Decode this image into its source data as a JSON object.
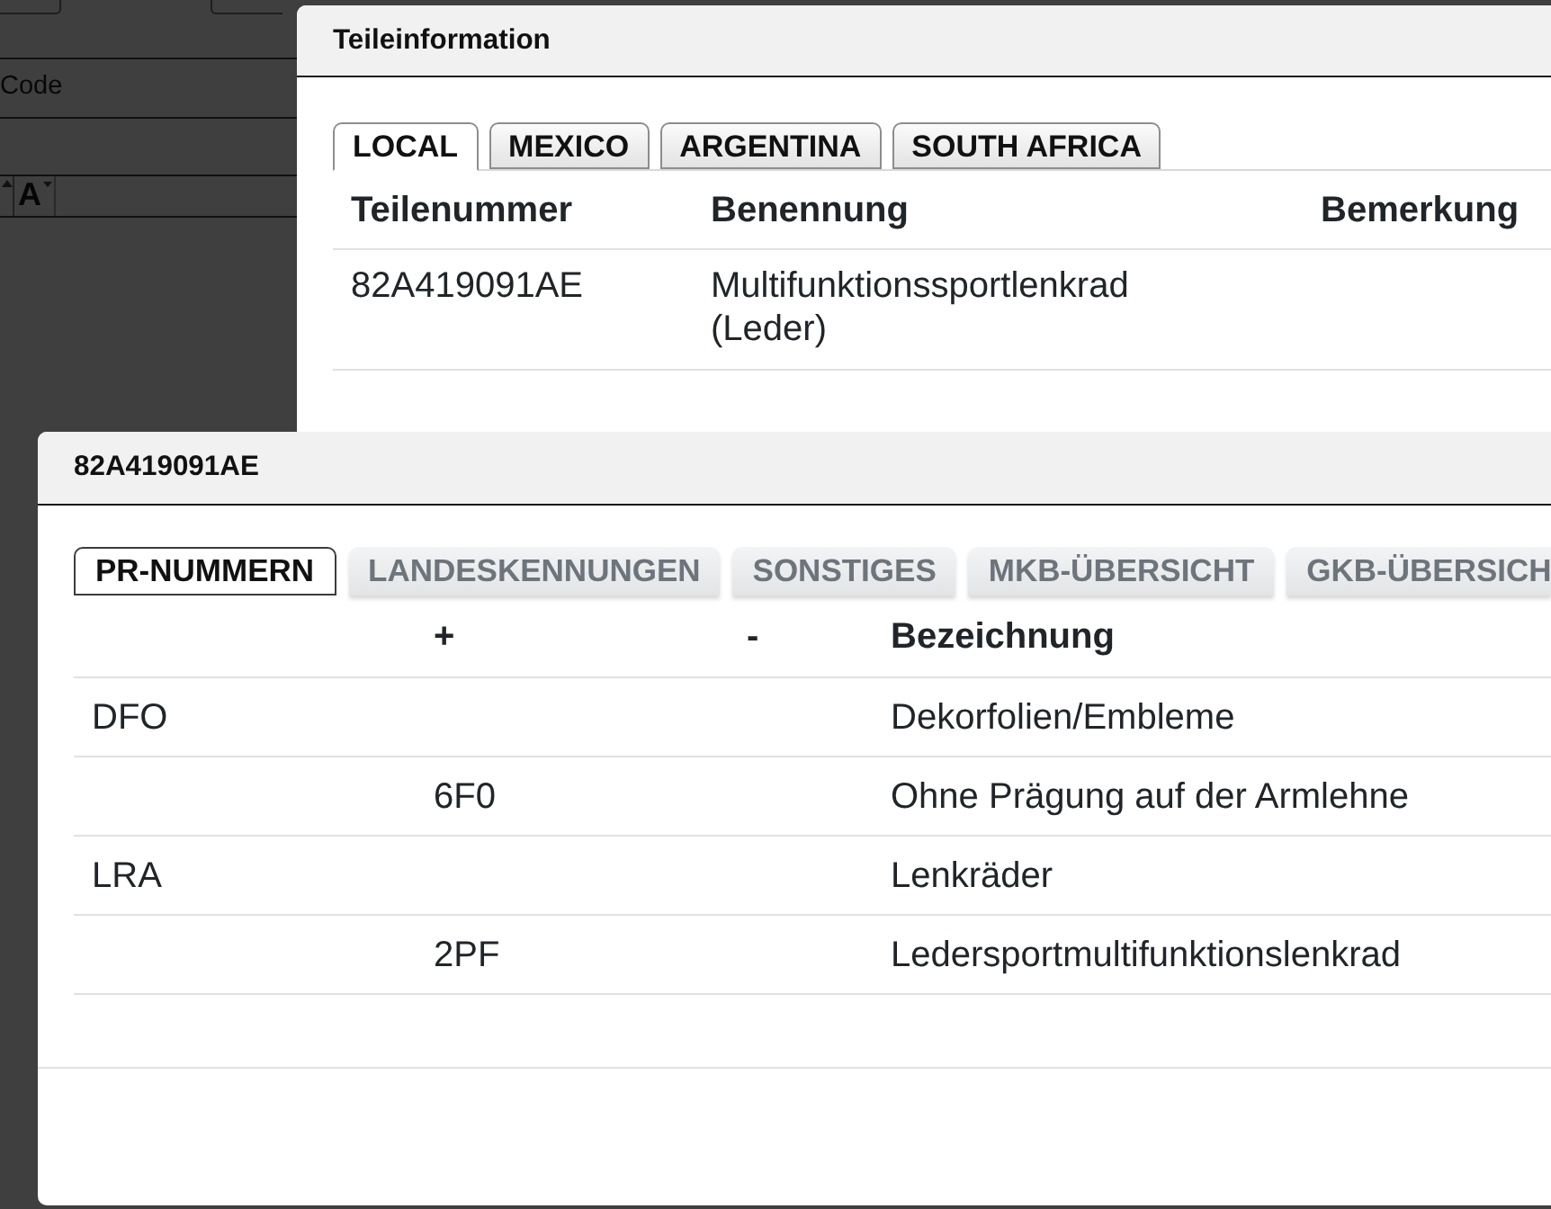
{
  "background": {
    "label": "Code",
    "font_button": "A"
  },
  "parts_dialog": {
    "title": "Teileinformation",
    "tabs": [
      {
        "label": "LOCAL",
        "selected": true
      },
      {
        "label": "MEXICO",
        "selected": false
      },
      {
        "label": "ARGENTINA",
        "selected": false
      },
      {
        "label": "SOUTH AFRICA",
        "selected": false
      }
    ],
    "table": {
      "columns": [
        "Teilenummer",
        "Benennung",
        "Bemerkung"
      ],
      "rows": [
        {
          "teilenummer": "82A419091AE",
          "benennung": "Multifunktionssportlenkrad (Leder)"
        }
      ]
    }
  },
  "detail_dialog": {
    "title": "82A419091AE",
    "tabs": [
      {
        "label": "PR-NUMMERN",
        "selected": true
      },
      {
        "label": "LANDESKENNUNGEN",
        "selected": false
      },
      {
        "label": "SONSTIGES",
        "selected": false
      },
      {
        "label": "MKB-ÜBERSICHT",
        "selected": false
      },
      {
        "label": "GKB-ÜBERSICH",
        "selected": false
      }
    ],
    "table": {
      "columns": [
        "+",
        "-",
        "Bezeichnung"
      ],
      "rows": [
        {
          "column_1": "DFO",
          "bezeichnung": "Dekorfolien/Embleme"
        },
        {
          "plus": "6F0",
          "bezeichnung": "Ohne Prägung auf der Armlehne"
        },
        {
          "column_1": "LRA",
          "bezeichnung": "Lenkräder"
        },
        {
          "plus": "2PF",
          "bezeichnung": "Ledersportmultifunktionslenkrad"
        }
      ]
    }
  }
}
